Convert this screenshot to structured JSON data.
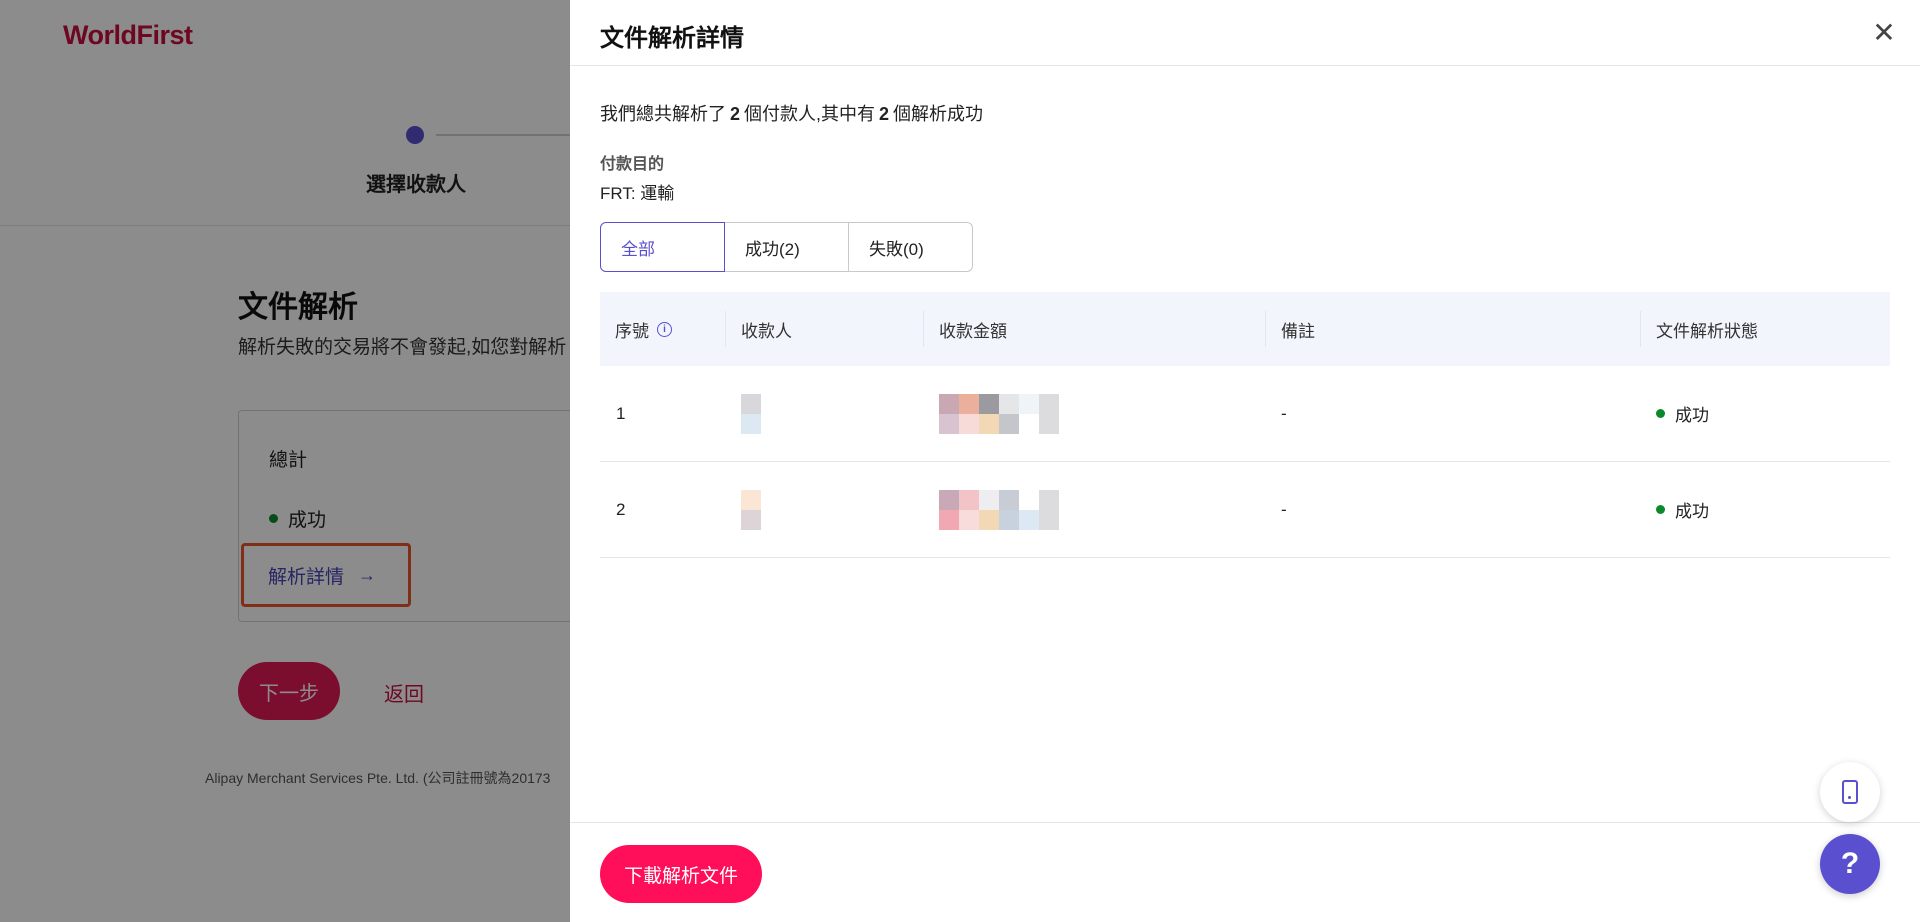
{
  "background": {
    "logo": "WorldFirst",
    "step_label": "選擇收款人",
    "title": "文件解析",
    "subtitle": "解析失敗的交易將不會發起,如您對解析",
    "summary_total": "總計",
    "summary_status": "成功",
    "detail_link": "解析詳情",
    "next_button": "下一步",
    "back_button": "返回",
    "footer": "Alipay Merchant Services Pte. Ltd. (公司註冊號為20173"
  },
  "drawer": {
    "title": "文件解析詳情",
    "summary_prefix": "我們總共解析了",
    "summary_total": "2",
    "summary_middle": "個付款人,其中有",
    "summary_success": "2",
    "summary_suffix": "個解析成功",
    "purpose_label": "付款目的",
    "purpose_value": "FRT: 運輸",
    "filters": [
      {
        "label": "全部"
      },
      {
        "label": "成功(2)"
      },
      {
        "label": "失敗(0)"
      }
    ],
    "columns": {
      "no": "序號",
      "payee": "收款人",
      "amount": "收款金額",
      "note": "備註",
      "status": "文件解析狀態"
    },
    "rows": [
      {
        "no": "1",
        "note": "-",
        "status": "成功"
      },
      {
        "no": "2",
        "note": "-",
        "status": "成功"
      }
    ],
    "download_button": "下載解析文件"
  },
  "colors": {
    "accent": "#5a4fcf",
    "brand": "#c8103e",
    "primary_button": "#ff0f5a",
    "success": "#0b8a2b"
  },
  "icons": {
    "close": "close-icon",
    "info": "info-icon",
    "arrow": "arrow-right-icon",
    "phone": "phone-icon",
    "help": "help-icon"
  }
}
